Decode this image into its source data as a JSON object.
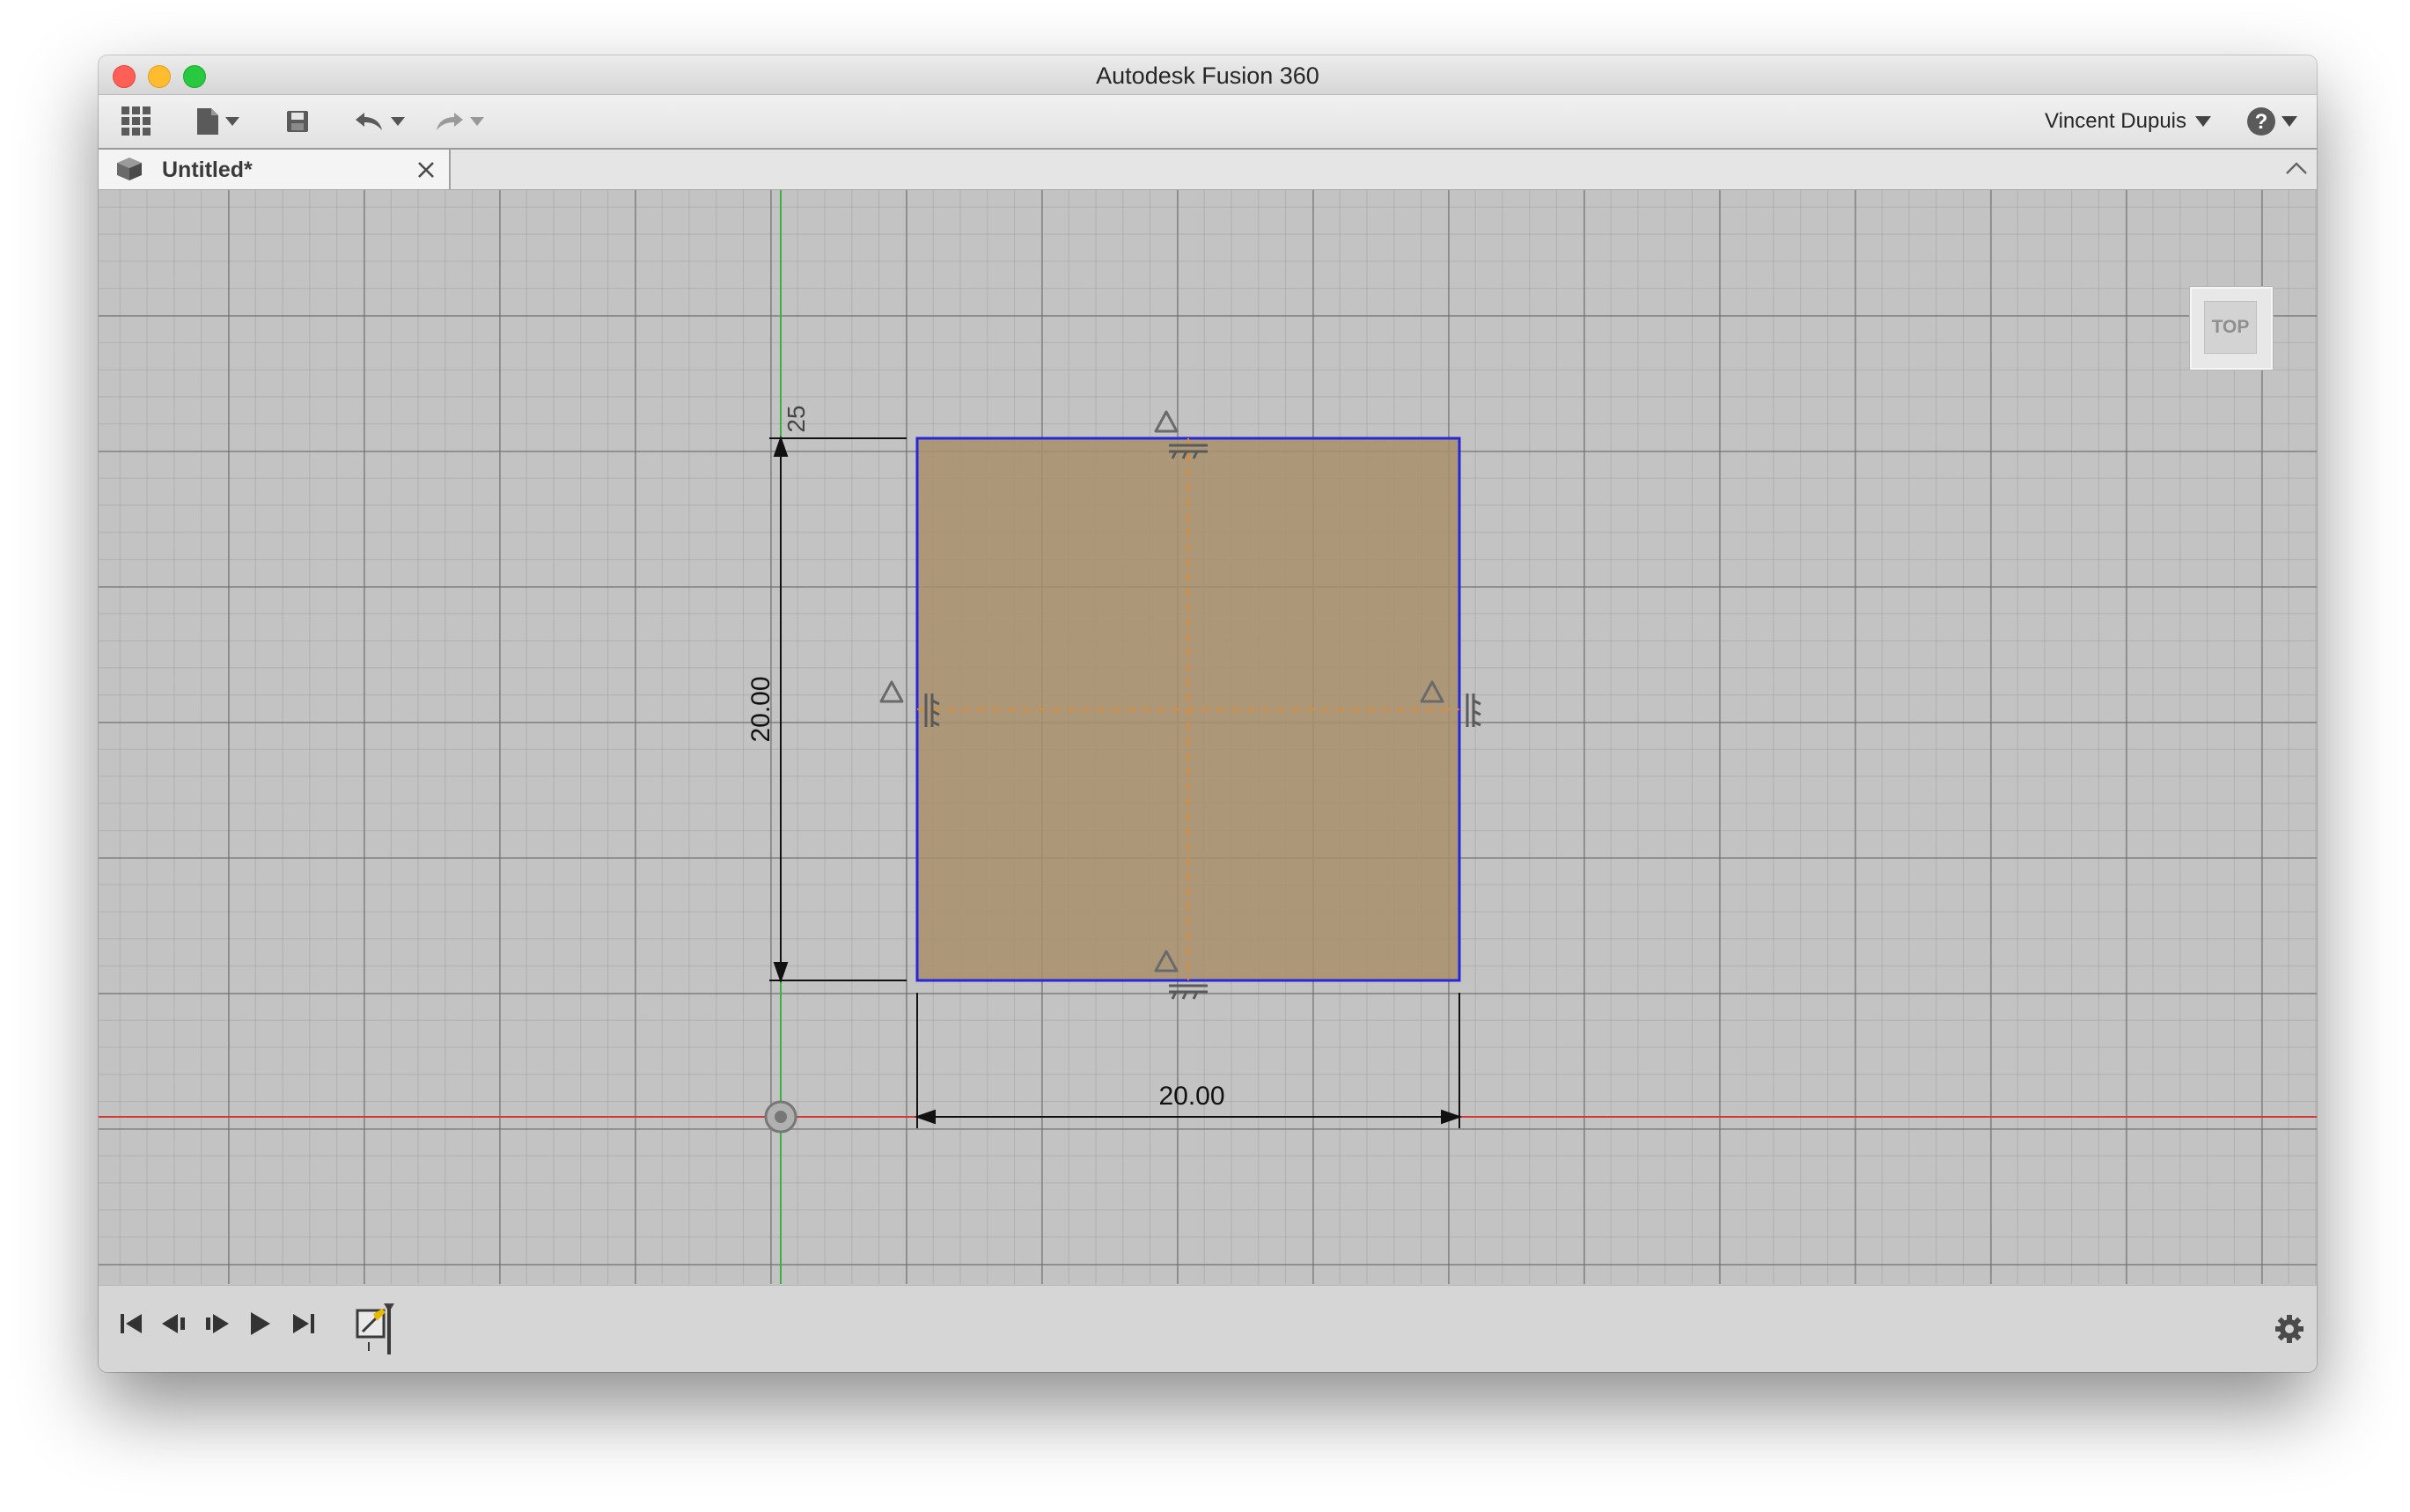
{
  "app": {
    "title": "Autodesk Fusion 360"
  },
  "toolbar": {
    "user_name": "Vincent Dupuis",
    "icons": [
      "grid-icon",
      "file-icon",
      "save-icon",
      "undo-icon",
      "redo-icon",
      "help-icon"
    ]
  },
  "tabs": [
    {
      "label": "Untitled*",
      "active": true
    }
  ],
  "viewcube": {
    "label": "TOP"
  },
  "sketch": {
    "vertical_dimension": "20.00",
    "horizontal_dimension": "20.00",
    "offset_dimension": "25",
    "colors": {
      "profile_fill": "#a8916c",
      "profile_edge": "#2727d8",
      "construction_line": "#e28a2e",
      "x_axis": "#d23a3a",
      "y_axis": "#3cb043",
      "dimension": "#111111"
    }
  },
  "timeline": {
    "controls": [
      "skip-to-start-icon",
      "step-back-icon",
      "step-forward-icon",
      "play-icon",
      "skip-to-end-icon"
    ],
    "feature": "sketch-feature-icon",
    "settings": "gear-icon"
  }
}
